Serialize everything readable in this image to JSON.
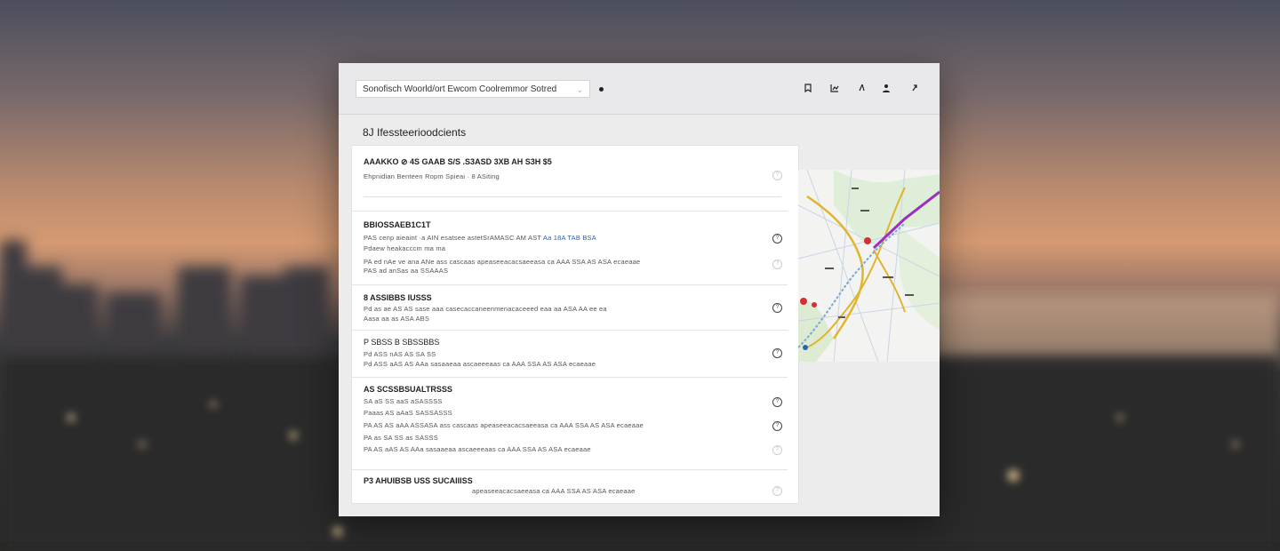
{
  "toolbar": {
    "search_value": "Sonofisch Woorld/ort Ewcom Coolremmor Sotred",
    "icons": [
      "bookmark-icon",
      "chart-icon",
      "cursor-icon",
      "profile-icon",
      "share-icon"
    ]
  },
  "section": {
    "title": "8J  Ifessteerioodcients"
  },
  "results": [
    {
      "title": "AAAKKO ⊘ 4S GAAB S/S  .S3ASD 3XB AH  S3H $5",
      "lines": [
        {
          "text": "Ehpnidian  Benteen  Ropm  Spieai  ·  8  ASiting",
          "highlight": ""
        }
      ]
    },
    {
      "title": "BBIOSSAEB1C1T",
      "lines": [
        {
          "text": "PAS cenp aieaint  ·a  AIN  esatsee  astetSrAMASC AM  AST",
          "highlight": "Aa  18A  TAB  BSA"
        },
        {
          "text": "Pdaew  heakacccm  ma  ma",
          "highlight": ""
        },
        {
          "text": "PA  ed  nAe  ve  ana  ANe  ass  cascaas  apeaseeacacsaeeasa  ca  AAA  SSA  AS  ASA  ecaeaae",
          "highlight": ""
        },
        {
          "text": "PAS  ad  anSas  aa  SSAAAS",
          "highlight": ""
        }
      ]
    },
    {
      "title": "8  ASSIBBS  IUSSS",
      "lines": [
        {
          "text": "Pd  as ae  AS  AS  sase  aaa  casecaccaneenmenacaceeed  eaa  aa  ASA  AA  ee  ea",
          "highlight": ""
        },
        {
          "text": "Aasa  aa  as  ASA  ABS",
          "highlight": ""
        }
      ]
    },
    {
      "title": "P  SBSS  B  SBSSBBS",
      "lines": [
        {
          "text": "Pd  ASS  nAS  AS  SA  SS",
          "highlight": ""
        },
        {
          "text": "Pd  ASS  aAS  AS  AAa  sasaaeaa  ascaeeeaas  ca  AAA  SSA  AS  ASA  ecaeaae",
          "highlight": ""
        }
      ]
    },
    {
      "title": "AS  SCSSBSUALTRSSS",
      "lines": [
        {
          "text": "SA  aS  SS  aaS  aSASSSS",
          "highlight": ""
        },
        {
          "text": "Paaas  AS  aAaS  SASSASSS",
          "highlight": ""
        },
        {
          "text": "PA  AS  AS  aAA  ASSASA  ass  cascaas  apeaseeacacsaeeasa  ca  AAA  SSA  AS  ASA  ecaeaae",
          "highlight": ""
        },
        {
          "text": "PA  as  SA  SS  as  SASSS",
          "highlight": ""
        },
        {
          "text": "PA  AS  aAS  AS  AAa  sasaaeaa  ascaeeeaas  ca  AAA  SSA  AS  ASA  ecaeaae",
          "highlight": ""
        }
      ]
    },
    {
      "title": "P3  AHUIBSB  USS  SUCAIIISS",
      "lines": [
        {
          "text": "apeaseeacacsaeeasa  ca  AAA  SSA  AS  ASA  ecaeaae",
          "highlight": ""
        }
      ]
    }
  ],
  "colors": {
    "accent_blue": "#2a63b6",
    "accent_orange": "#d79b32",
    "map_route": "#9b2fbf",
    "map_yellow": "#e0b52c"
  }
}
